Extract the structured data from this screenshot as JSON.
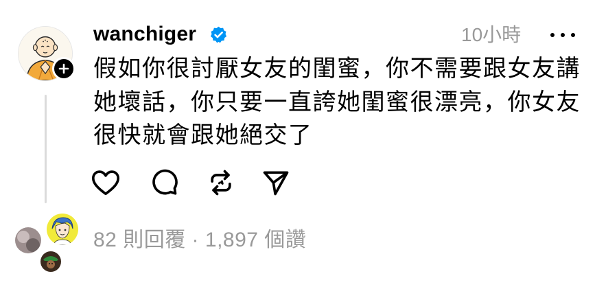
{
  "post": {
    "username": "wanchiger",
    "timestamp": "10小時",
    "text_lines": [
      "假如你很討厭女友的閨蜜，你不需要跟女友講",
      "她壞話，你只要一直誇她閨蜜很漂亮，你女友",
      "很快就會跟她絕交了"
    ]
  },
  "stats": {
    "replies": "82 則回覆",
    "separator": " · ",
    "likes": "1,897 個讚"
  },
  "icons": {
    "avatar": "monk-avatar",
    "follow": "plus-icon",
    "verified": "verified-badge-icon",
    "more": "more-options-icon",
    "like": "heart-icon",
    "reply": "comment-icon",
    "repost": "repost-icon",
    "share": "send-icon"
  },
  "colors": {
    "verified": "#0095f6",
    "secondary_text": "#999999",
    "thread_line": "#dbdbdb"
  }
}
